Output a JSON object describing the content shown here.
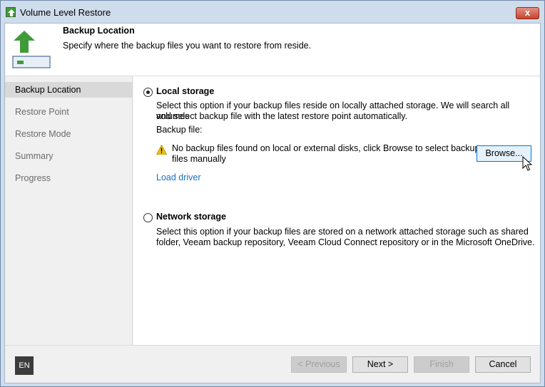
{
  "window": {
    "title": "Volume Level Restore",
    "close_glyph": "x"
  },
  "header": {
    "title": "Backup Location",
    "description": "Specify where the backup files you want to restore from reside."
  },
  "sidebar": {
    "items": [
      {
        "label": "Backup Location",
        "active": true
      },
      {
        "label": "Restore Point",
        "active": false
      },
      {
        "label": "Restore Mode",
        "active": false
      },
      {
        "label": "Summary",
        "active": false
      },
      {
        "label": "Progress",
        "active": false
      }
    ]
  },
  "local": {
    "label": "Local storage",
    "selected": true,
    "desc_line1": "Select this option if your backup files reside on locally attached storage. We will search all volumes",
    "desc_line2": "and select backup file with the latest restore point automatically.",
    "backup_file_label": "Backup file:",
    "warning_line1": "No backup files found on local or external disks, click Browse to select backup",
    "warning_line2": "files manually",
    "browse_label": "Browse...",
    "load_driver_label": "Load driver"
  },
  "network": {
    "label": "Network storage",
    "selected": false,
    "desc_line1": "Select this option if your backup files are stored on a network attached storage such as shared",
    "desc_line2": "folder, Veeam backup repository, Veeam Cloud Connect repository or in the Microsoft OneDrive."
  },
  "footer": {
    "language": "EN",
    "previous_label": "< Previous",
    "next_label": "Next >",
    "finish_label": "Finish",
    "cancel_label": "Cancel"
  },
  "icons": {
    "app": "restore-arrow-icon",
    "header": "volume-restore-icon",
    "warning": "warning-icon",
    "cursor": "mouse-cursor-icon"
  },
  "colors": {
    "accent_green": "#3f9b3a",
    "link_blue": "#1a6fc4",
    "warning_yellow": "#f2c100"
  }
}
